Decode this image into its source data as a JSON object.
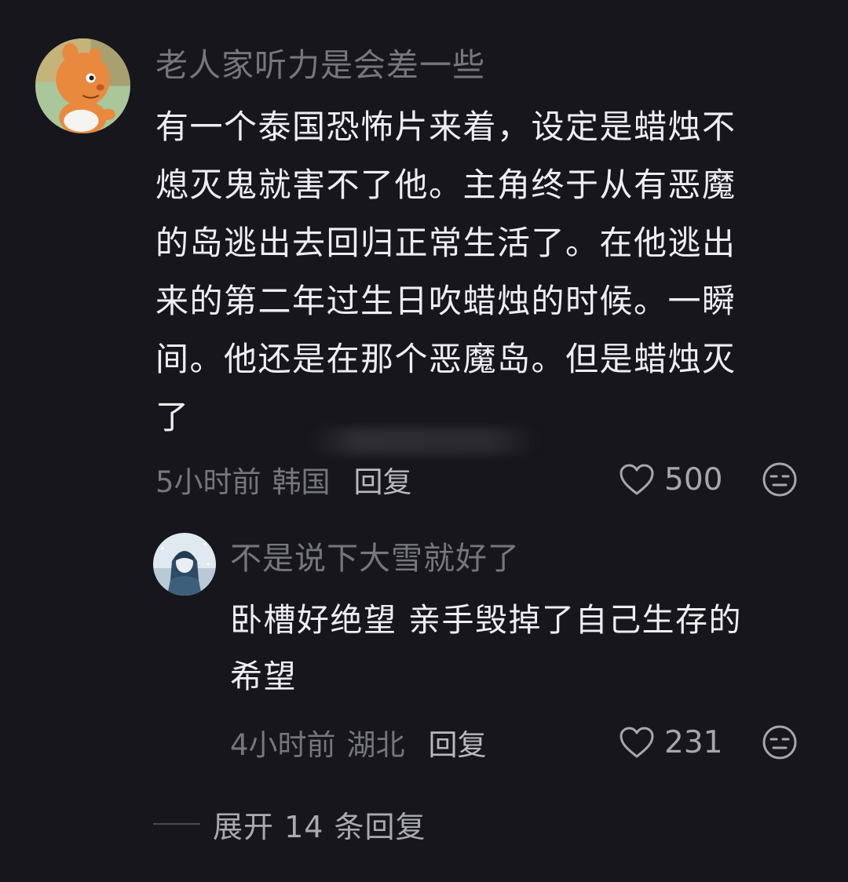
{
  "colors": {
    "background": "#16161c",
    "username": "#76767e",
    "body_text": "#eeeef2",
    "meta_text": "#76767e",
    "reply_button": "#b9b9c0",
    "like_count": "#a6a6ae"
  },
  "comment": {
    "username": "老人家听力是会差一些",
    "text": "有一个泰国恐怖片来着，设定是蜡烛不\n熄灭鬼就害不了他。主角终于从有恶魔\n的岛逃出去回归正常生活了。在他逃出\n来的第二年过生日吹蜡烛的时候。一瞬\n间。他还是在那个恶魔岛。但是蜡烛灭\n了",
    "time": "5小时前",
    "location": "韩国",
    "reply_label": "回复",
    "like_count": "500",
    "avatar_icon": "cartoon-baby-avatar",
    "like_icon": "heart-outline-icon",
    "dislike_icon": "unamused-face-icon"
  },
  "reply": {
    "username": "不是说下大雪就好了",
    "text": "卧槽好绝望 亲手毁掉了自己生存的\n希望",
    "time": "4小时前",
    "location": "湖北",
    "reply_label": "回复",
    "like_count": "231",
    "avatar_icon": "anime-character-avatar",
    "like_icon": "heart-outline-icon",
    "dislike_icon": "unamused-face-icon"
  },
  "expand_replies": {
    "label": "展开 14 条回复"
  }
}
